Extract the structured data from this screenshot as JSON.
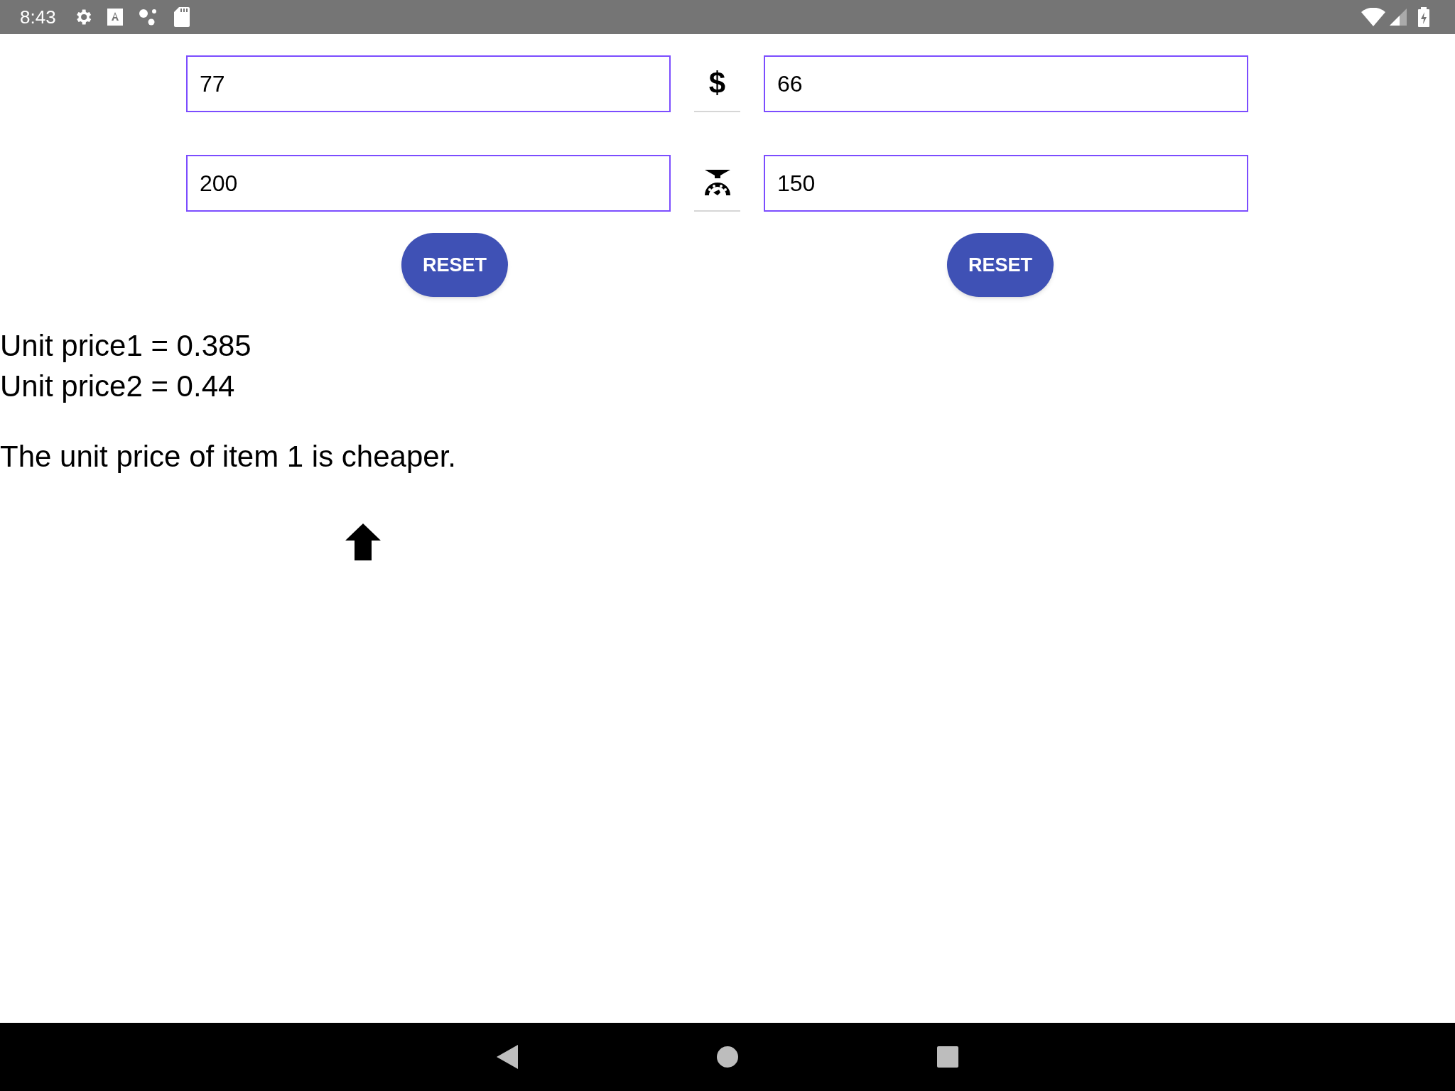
{
  "status_bar": {
    "time": "8:43"
  },
  "rows": [
    {
      "left_value": "77",
      "symbol": "$",
      "kind": "text",
      "right_value": "66"
    },
    {
      "left_value": "200",
      "kind": "scale",
      "right_value": "150"
    }
  ],
  "buttons": [
    "RESET",
    "RESET"
  ],
  "results": [
    "Unit price1 = 0.385",
    "Unit price2 = 0.44"
  ],
  "conclusion": "The unit price of item 1 is cheaper."
}
